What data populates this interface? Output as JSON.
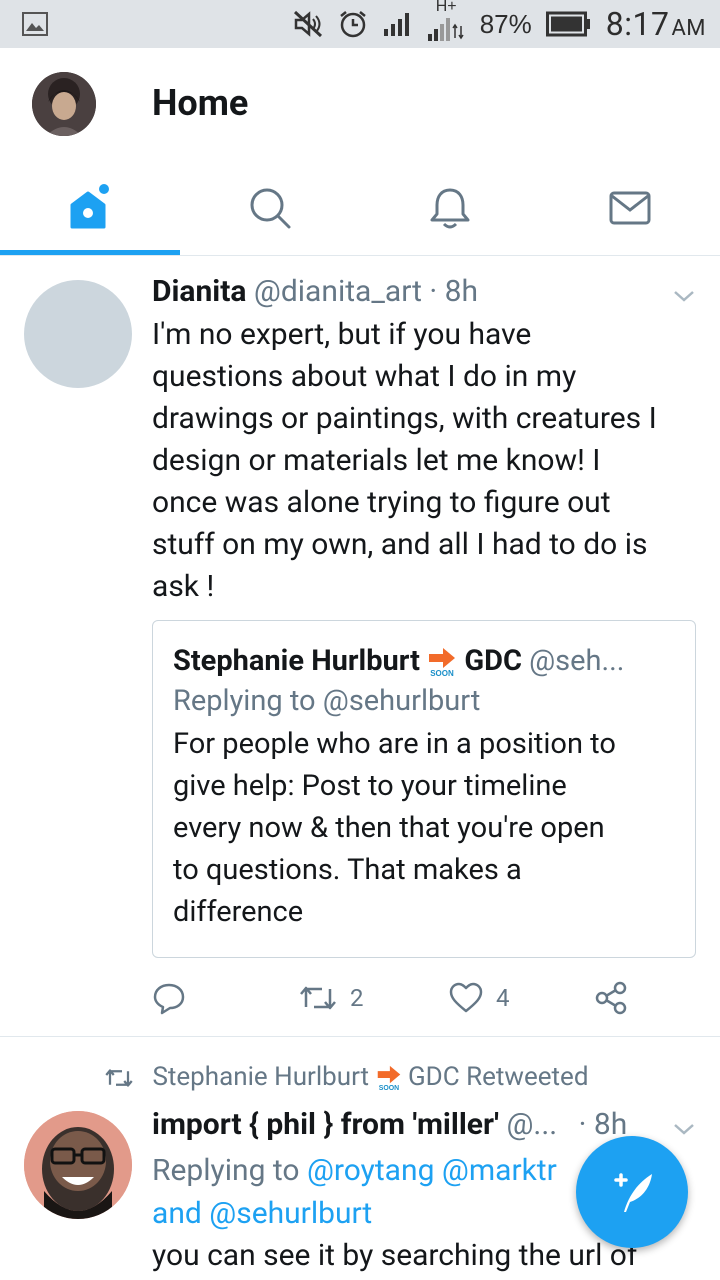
{
  "status_bar": {
    "battery": "87%",
    "time": "8:17",
    "ampm": "AM",
    "network": "H+"
  },
  "header": {
    "title": "Home",
    "tabs": [
      {
        "name": "home",
        "icon": "home-icon",
        "active": true
      },
      {
        "name": "search",
        "icon": "search-icon",
        "active": false
      },
      {
        "name": "notifications",
        "icon": "bell-icon",
        "active": false
      },
      {
        "name": "messages",
        "icon": "mail-icon",
        "active": false
      }
    ]
  },
  "colors": {
    "accent": "#1da1f2",
    "muted": "#657786",
    "text": "#14171a",
    "retweet": "#657786"
  },
  "tweet1": {
    "name": "Dianita",
    "handle": "@dianita_art",
    "time": "· 8h",
    "lines": [
      "I'm no expert, but if you have",
      "questions about what I do in my",
      "drawings or paintings, with creatures I",
      "design or materials let me know! I",
      "once was alone trying to figure out",
      "stuff on my own, and all I had to do is",
      "ask !"
    ],
    "quote": {
      "name_a": "Stephanie Hurlburt",
      "name_b": "GDC",
      "handle": "@seh...",
      "replying": "Replying to @sehurlburt",
      "lines": [
        "For people who are in a position to",
        "give help: Post to your timeline",
        "every now & then that you're open",
        "to questions. That makes a",
        "difference"
      ]
    },
    "retweets": "2",
    "likes": "4"
  },
  "tweet2": {
    "retweeted_by_a": "Stephanie Hurlburt",
    "retweeted_by_b": "GDC Retweeted",
    "name": "import { phil } from 'miller'",
    "handle": "@...",
    "time": "· 8h",
    "replying_label": "Replying to",
    "replying_to_1": "@roytang",
    "replying_to_2": "@marktr",
    "replying_and": "and",
    "replying_to_3": "@sehurlburt",
    "body_start": "you can see it by searching the url of"
  }
}
